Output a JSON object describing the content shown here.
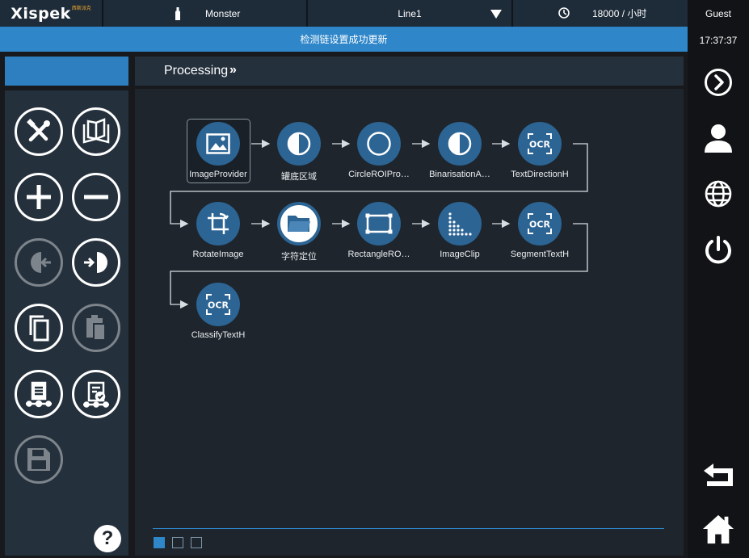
{
  "topbar": {
    "logo": "Xispek",
    "logo_sub": "西斯派克",
    "product": "Monster",
    "line": "Line1",
    "speed": "18000 / 小时"
  },
  "status_message": "检测链设置成功更新",
  "right_sidebar": {
    "user": "Guest",
    "time": "17:37:37",
    "icons": [
      "next-icon",
      "user-icon",
      "globe-icon",
      "power-icon",
      "back-icon",
      "home-icon"
    ]
  },
  "main": {
    "header_title": "Processing",
    "header_chevron": "»"
  },
  "flow": {
    "nodes": [
      {
        "label": "ImageProvider",
        "icon": "image-icon"
      },
      {
        "label": "罐底区域",
        "icon": "half-circle-icon"
      },
      {
        "label": "CircleROIPro…",
        "icon": "circle-icon"
      },
      {
        "label": "BinarisationA…",
        "icon": "half-circle-icon"
      },
      {
        "label": "TextDirectionH",
        "icon": "ocr-icon"
      },
      {
        "label": "RotateImage",
        "icon": "crop-rotate-icon"
      },
      {
        "label": "字符定位",
        "icon": "folder-icon"
      },
      {
        "label": "RectangleRO…",
        "icon": "rectangle-icon"
      },
      {
        "label": "ImageClip",
        "icon": "dots-icon"
      },
      {
        "label": "SegmentTextH",
        "icon": "ocr-icon"
      },
      {
        "label": "ClassifyTextH",
        "icon": "ocr-icon"
      }
    ],
    "ocr_text": "OCR"
  },
  "left_tools": [
    "tools-icon",
    "book-icon",
    "plus-icon",
    "minus-icon",
    "input-icon",
    "output-icon",
    "copy-icon",
    "paste-icon",
    "clipboard-flow-icon",
    "clipboard-check-icon",
    "save-icon"
  ],
  "help_label": "?",
  "colors": {
    "accent": "#2f86c9",
    "node": "#2c6494",
    "panel": "#24303c"
  }
}
